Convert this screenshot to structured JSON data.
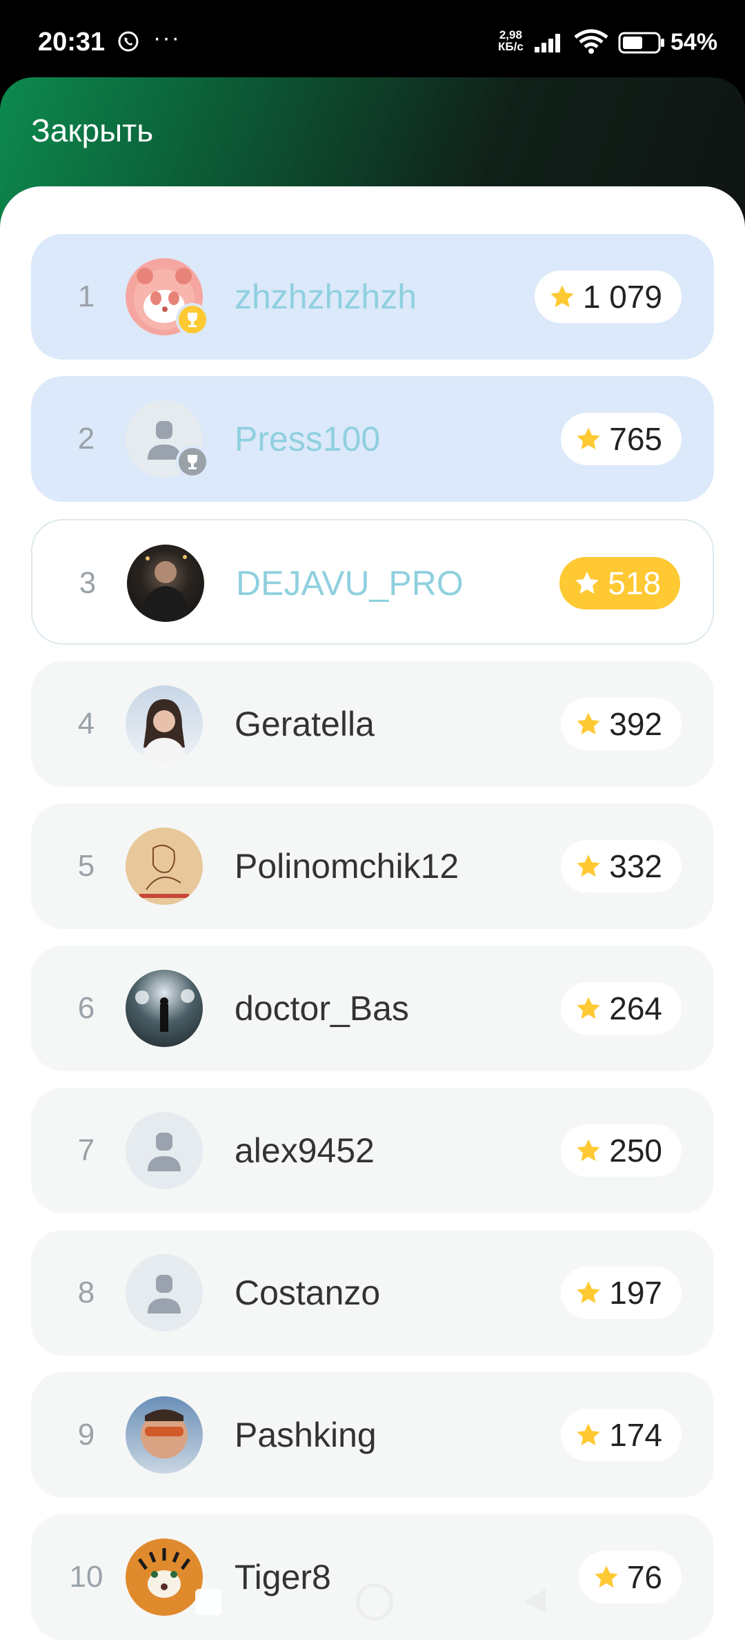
{
  "status_bar": {
    "time": "20:31",
    "more": "···",
    "net_speed_value": "2,98",
    "net_speed_unit": "КБ/с",
    "battery": "54%"
  },
  "header": {
    "close_label": "Закрыть"
  },
  "colors": {
    "accent_green": "#0d8a4e",
    "highlight_name": "#8fd0df",
    "star": "#ffc933",
    "top_row_bg": "#dce9fa"
  },
  "leaderboard": [
    {
      "rank": "1",
      "name": "zhzhzhzhzh",
      "score": "1 079",
      "avatar": "panda-avatar",
      "badge": "gold-trophy-icon"
    },
    {
      "rank": "2",
      "name": "Press100",
      "score": "765",
      "avatar": "default-user-avatar",
      "badge": "silver-trophy-icon"
    },
    {
      "rank": "3",
      "name": "DEJAVU_PRO",
      "score": "518",
      "avatar": "photo-avatar"
    },
    {
      "rank": "4",
      "name": "Geratella",
      "score": "392",
      "avatar": "photo-avatar"
    },
    {
      "rank": "5",
      "name": "Polinomchik12",
      "score": "332",
      "avatar": "drawing-avatar"
    },
    {
      "rank": "6",
      "name": "doctor_Bas",
      "score": "264",
      "avatar": "photo-avatar"
    },
    {
      "rank": "7",
      "name": "alex9452",
      "score": "250",
      "avatar": "default-user-avatar"
    },
    {
      "rank": "8",
      "name": "Costanzo",
      "score": "197",
      "avatar": "default-user-avatar"
    },
    {
      "rank": "9",
      "name": "Pashking",
      "score": "174",
      "avatar": "photo-avatar"
    },
    {
      "rank": "10",
      "name": "Tiger8",
      "score": "76",
      "avatar": "tiger-avatar"
    }
  ]
}
